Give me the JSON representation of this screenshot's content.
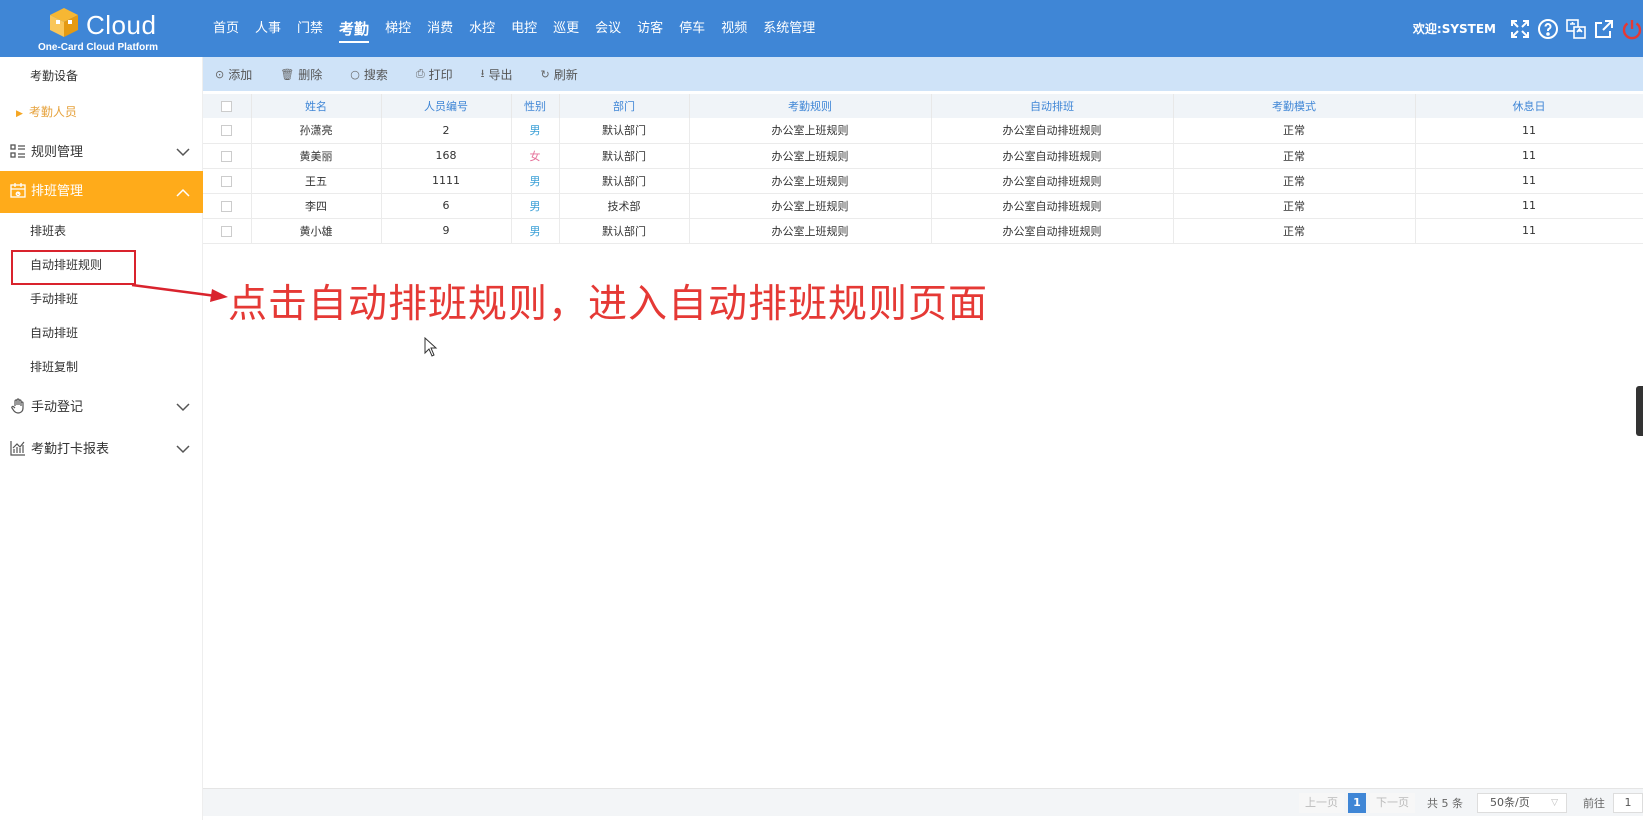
{
  "header": {
    "logo_text": "Cloud",
    "logo_sub": "One-Card Cloud Platform",
    "nav": [
      {
        "label": "首页"
      },
      {
        "label": "人事"
      },
      {
        "label": "门禁"
      },
      {
        "label": "考勤",
        "active": true
      },
      {
        "label": "梯控"
      },
      {
        "label": "消费"
      },
      {
        "label": "水控"
      },
      {
        "label": "电控"
      },
      {
        "label": "巡更"
      },
      {
        "label": "会议"
      },
      {
        "label": "访客"
      },
      {
        "label": "停车"
      },
      {
        "label": "视频"
      },
      {
        "label": "系统管理"
      }
    ],
    "welcome": "欢迎:SYSTEM",
    "icons": [
      "fullscreen-icon",
      "help-icon",
      "language-icon",
      "external-link-icon",
      "power-icon"
    ]
  },
  "sidebar": {
    "sub_top": [
      {
        "label": "考勤设备"
      },
      {
        "label": "考勤人员",
        "active": true
      }
    ],
    "groups": [
      {
        "label": "规则管理",
        "icon": "list-icon"
      },
      {
        "label": "排班管理",
        "icon": "calendar-icon",
        "open": true
      },
      {
        "label": "手动登记",
        "icon": "hand-icon"
      },
      {
        "label": "考勤打卡报表",
        "icon": "chart-icon"
      }
    ],
    "schedule_items": [
      {
        "label": "排班表"
      },
      {
        "label": "自动排班规则"
      },
      {
        "label": "手动排班"
      },
      {
        "label": "自动排班"
      },
      {
        "label": "排班复制"
      }
    ]
  },
  "toolbar": {
    "buttons": [
      {
        "label": "添加",
        "icon": "⊙"
      },
      {
        "label": "删除",
        "icon": "🗑"
      },
      {
        "label": "搜索",
        "icon": "○"
      },
      {
        "label": "打印",
        "icon": "⎙"
      },
      {
        "label": "导出",
        "icon": "⭳"
      },
      {
        "label": "刷新",
        "icon": "↻"
      }
    ]
  },
  "table": {
    "columns": [
      "姓名",
      "人员编号",
      "性别",
      "部门",
      "考勤规则",
      "自动排班",
      "考勤模式",
      "休息日"
    ],
    "rows": [
      [
        "孙潇亮",
        "2",
        "男",
        "默认部门",
        "办公室上班规则",
        "办公室自动排班规则",
        "正常",
        "11"
      ],
      [
        "黄美丽",
        "168",
        "女",
        "默认部门",
        "办公室上班规则",
        "办公室自动排班规则",
        "正常",
        "11"
      ],
      [
        "王五",
        "1111",
        "男",
        "默认部门",
        "办公室上班规则",
        "办公室自动排班规则",
        "正常",
        "11"
      ],
      [
        "李四",
        "6",
        "男",
        "技术部",
        "办公室上班规则",
        "办公室自动排班规则",
        "正常",
        "11"
      ],
      [
        "黄小雄",
        "9",
        "男",
        "默认部门",
        "办公室上班规则",
        "办公室自动排班规则",
        "正常",
        "11"
      ]
    ]
  },
  "annotation": "点击自动排班规则，进入自动排班规则页面",
  "pager": {
    "prev": "上一页",
    "current": "1",
    "next": "下一页",
    "total": "共 5 条",
    "page_size": "50条/页",
    "goto_label": "前往",
    "goto_value": "1"
  },
  "colors": {
    "header_bg": "#3f86d6",
    "accent_orange": "#ffab1a",
    "annotation_red": "#e53935"
  }
}
